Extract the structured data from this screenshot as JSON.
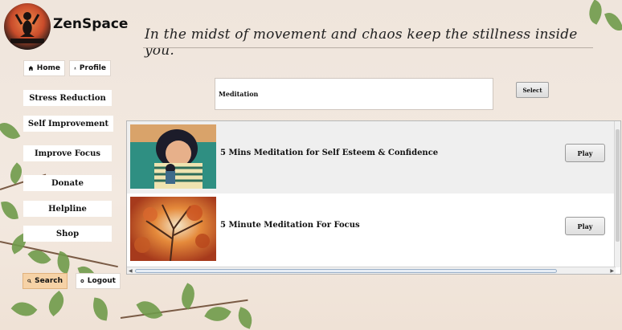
{
  "app": {
    "name": "ZenSpace"
  },
  "header": {
    "quote": "In the midst of movement and chaos keep the stillness inside you."
  },
  "top_buttons": {
    "home": "Home",
    "profile": "Profile"
  },
  "sidebar": {
    "items": [
      {
        "label": "Stress Reduction"
      },
      {
        "label": "Self Improvement"
      },
      {
        "label": "Improve Focus"
      },
      {
        "label": "Donate"
      },
      {
        "label": "Helpline"
      },
      {
        "label": "Shop"
      }
    ],
    "search_label": "Search",
    "logout_label": "Logout"
  },
  "search": {
    "value": "Meditation",
    "select_label": "Select"
  },
  "results": [
    {
      "title": "5 Mins Meditation for Self Esteem & Confidence",
      "play_label": "Play"
    },
    {
      "title": "5 Minute Meditation For Focus",
      "play_label": "Play"
    }
  ],
  "colors": {
    "background": "#efe5dc",
    "leaf": "#6f9a4a",
    "search_btn_bg": "#f6d2a6"
  }
}
